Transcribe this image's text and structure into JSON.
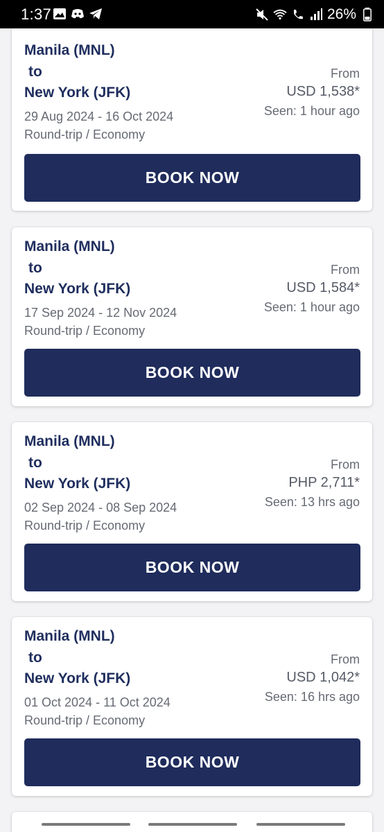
{
  "status_bar": {
    "time": "1:37",
    "battery": "26%",
    "left_icons": [
      "image-icon",
      "discord-icon",
      "telegram-icon"
    ],
    "right_icons": [
      "mute-icon",
      "wifi-icon",
      "wifi-call-icon",
      "signal-icon",
      "battery-icon"
    ]
  },
  "cards": [
    {
      "origin": "Manila (MNL)",
      "connector": "to",
      "destination": "New York (JFK)",
      "dates": "29 Aug 2024 - 16 Oct 2024",
      "trip_type": "Round-trip / Economy",
      "from_label": "From",
      "price": "USD 1,538*",
      "seen": "Seen: 1 hour ago",
      "button": "BOOK NOW"
    },
    {
      "origin": "Manila (MNL)",
      "connector": "to",
      "destination": "New York (JFK)",
      "dates": "17 Sep 2024 - 12 Nov 2024",
      "trip_type": "Round-trip / Economy",
      "from_label": "From",
      "price": "USD 1,584*",
      "seen": "Seen: 1 hour ago",
      "button": "BOOK NOW"
    },
    {
      "origin": "Manila (MNL)",
      "connector": "to",
      "destination": "New York (JFK)",
      "dates": "02 Sep 2024 - 08 Sep 2024",
      "trip_type": "Round-trip / Economy",
      "from_label": "From",
      "price": "PHP 2,711*",
      "seen": "Seen: 13 hrs ago",
      "button": "BOOK NOW"
    },
    {
      "origin": "Manila (MNL)",
      "connector": "to",
      "destination": "New York (JFK)",
      "dates": "01 Oct 2024 - 11 Oct 2024",
      "trip_type": "Round-trip / Economy",
      "from_label": "From",
      "price": "USD 1,042*",
      "seen": "Seen: 16 hrs ago",
      "button": "BOOK NOW"
    }
  ],
  "colors": {
    "primary": "#1f2c5c",
    "route_text": "#1f2e5e",
    "muted_text": "#666a73",
    "background": "#f3f3f5"
  }
}
